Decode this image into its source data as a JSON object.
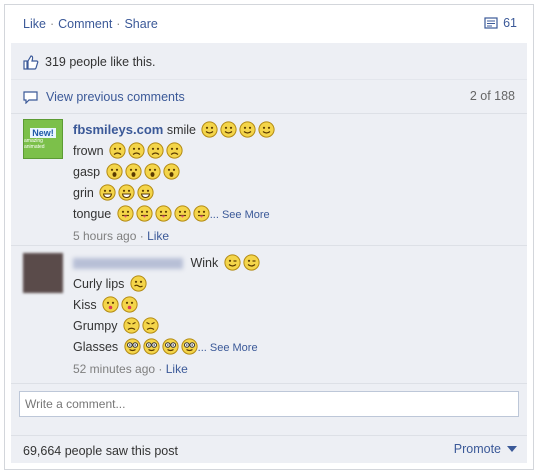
{
  "actions": {
    "like": "Like",
    "comment": "Comment",
    "share": "Share",
    "separator": "·",
    "share_count": "61"
  },
  "likes": {
    "text": "319 people like this."
  },
  "view_previous": {
    "label": "View previous comments",
    "count": "2 of 188"
  },
  "comment1": {
    "name": "fbsmileys.com",
    "avatar_text_top": "New!",
    "avatar_text_small": "amazing animated",
    "lines": {
      "smile": "smile",
      "frown": "frown",
      "gasp": "gasp",
      "grin": "grin",
      "tongue": "tongue"
    },
    "see_more": "... See More",
    "time": "5 hours ago",
    "like": "Like"
  },
  "comment2": {
    "lines": {
      "wink": "Wink",
      "curly": "Curly lips",
      "kiss": "Kiss",
      "grumpy": "Grumpy",
      "glasses": "Glasses"
    },
    "see_more": "... See More",
    "time": "52 minutes ago",
    "like": "Like"
  },
  "write_comment": {
    "placeholder": "Write a comment..."
  },
  "footer": {
    "seen": "69,664 people saw this post",
    "promote": "Promote"
  },
  "colors": {
    "link": "#3b5998",
    "box": "#edeff4",
    "emoji_face": "#f4d54a"
  }
}
